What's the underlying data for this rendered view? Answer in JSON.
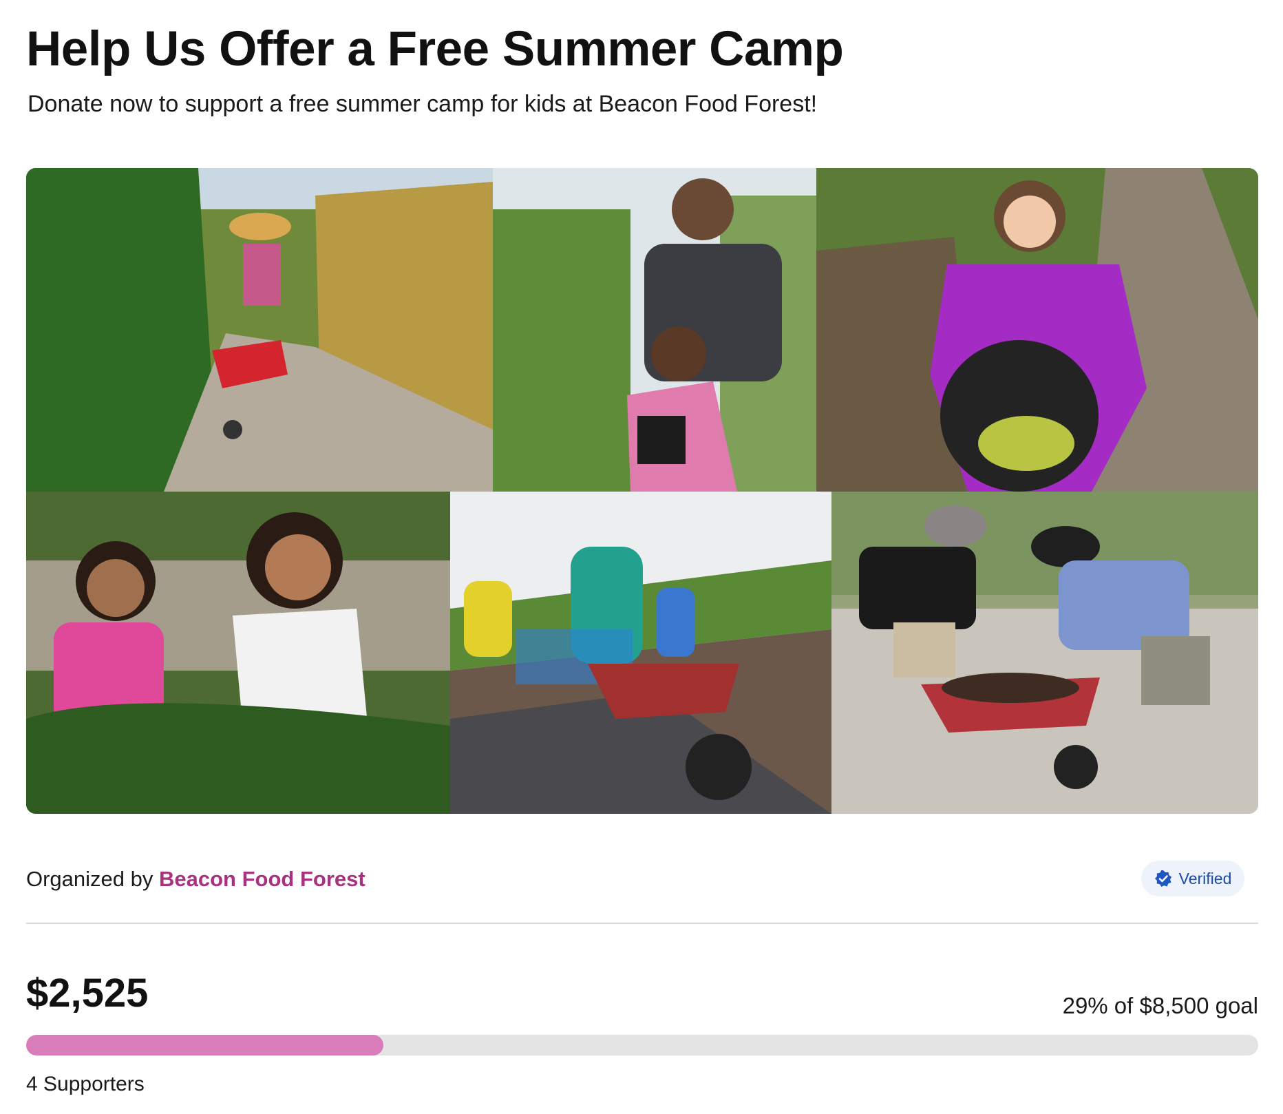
{
  "campaign": {
    "title": "Help Us Offer a Free Summer Camp",
    "subtitle": "Donate now to support a free summer camp for kids at Beacon Food Forest!"
  },
  "organizer": {
    "prefix": "Organized by",
    "name": "Beacon Food Forest",
    "badge_label": "Verified",
    "badge_icon": "verified-check-icon"
  },
  "progress": {
    "raised": "$2,525",
    "goal_text": "29% of $8,500 goal",
    "fraction": 0.29,
    "supporters": "4 Supporters"
  },
  "colors": {
    "accent": "#a8327f",
    "progress_fill": "#d87dba",
    "badge_text": "#1b4aa8",
    "badge_bg": "#eef3fb"
  }
}
